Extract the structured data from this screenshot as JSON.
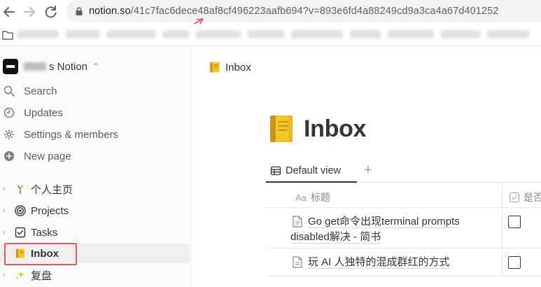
{
  "browser": {
    "url_host": "notion.so",
    "url_path": "/41c7fac6dece48af8cf496223aafb694?v=893e6fd4a88249cd9a3ca4a67d401252"
  },
  "workspace": {
    "name": "s Notion"
  },
  "sidebar": {
    "nav": [
      {
        "label": "Search",
        "icon": "search-icon"
      },
      {
        "label": "Updates",
        "icon": "clock-icon"
      },
      {
        "label": "Settings & members",
        "icon": "gear-icon"
      },
      {
        "label": "New page",
        "icon": "plus-circle-icon"
      }
    ],
    "pages": [
      {
        "label": "个人主页",
        "icon": "plant-emoji-icon"
      },
      {
        "label": "Projects",
        "icon": "target-icon"
      },
      {
        "label": "Tasks",
        "icon": "checkbox-icon"
      },
      {
        "label": "Inbox",
        "icon": "ledger-emoji-icon",
        "active": true
      },
      {
        "label": "复盘",
        "icon": "sparkles-emoji-icon"
      }
    ]
  },
  "main": {
    "breadcrumb": "Inbox",
    "title": "Inbox",
    "view_tab": "Default view",
    "view_add": "+",
    "table": {
      "columns": [
        {
          "label": "标题",
          "type_icon": "Aa"
        },
        {
          "label": "是否"
        }
      ],
      "rows": [
        {
          "title": "Go get命令出现terminal prompts disabled解决 - 简书",
          "checked": false
        },
        {
          "title": "玩 AI 人独特的混成群红的方式",
          "checked": false
        }
      ]
    }
  },
  "colors": {
    "sidebar_bg": "#fbfbfa",
    "text": "#37352f",
    "annotation_red": "#e8585a"
  }
}
